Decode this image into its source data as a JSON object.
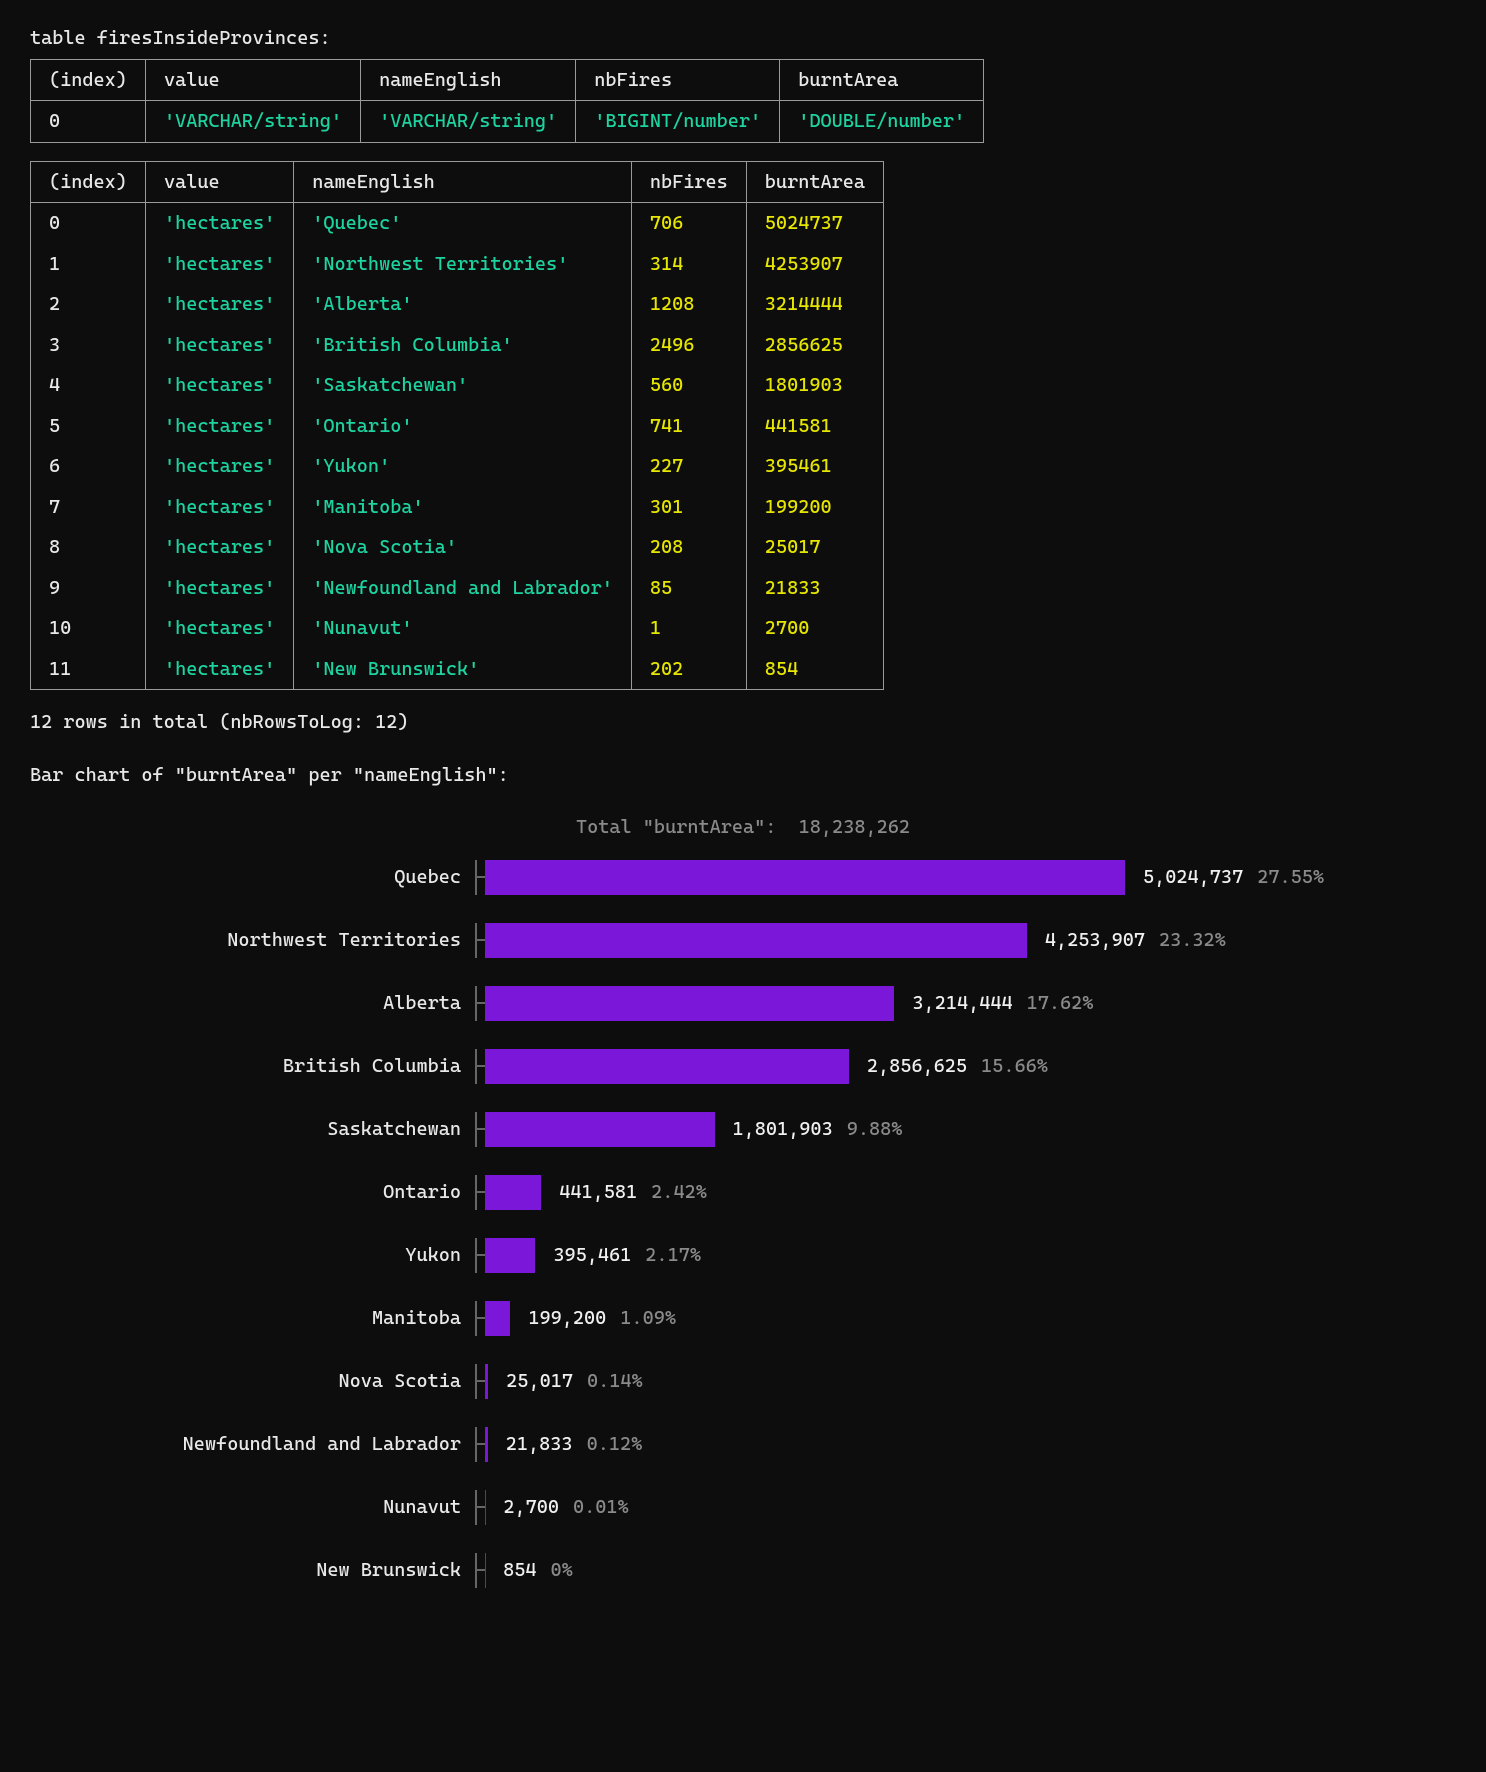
{
  "header": {
    "table_title": "table firesInsideProvinces:"
  },
  "schema_table": {
    "headers": [
      "(index)",
      "value",
      "nameEnglish",
      "nbFires",
      "burntArea"
    ],
    "rows": [
      {
        "index": "0",
        "value": "'VARCHAR/string'",
        "nameEnglish": "'VARCHAR/string'",
        "nbFires": "'BIGINT/number'",
        "burntArea": "'DOUBLE/number'"
      }
    ]
  },
  "data_table": {
    "headers": [
      "(index)",
      "value",
      "nameEnglish",
      "nbFires",
      "burntArea"
    ],
    "rows": [
      {
        "index": "0",
        "value": "'hectares'",
        "nameEnglish": "'Quebec'",
        "nbFires": "706",
        "burntArea": "5024737"
      },
      {
        "index": "1",
        "value": "'hectares'",
        "nameEnglish": "'Northwest Territories'",
        "nbFires": "314",
        "burntArea": "4253907"
      },
      {
        "index": "2",
        "value": "'hectares'",
        "nameEnglish": "'Alberta'",
        "nbFires": "1208",
        "burntArea": "3214444"
      },
      {
        "index": "3",
        "value": "'hectares'",
        "nameEnglish": "'British Columbia'",
        "nbFires": "2496",
        "burntArea": "2856625"
      },
      {
        "index": "4",
        "value": "'hectares'",
        "nameEnglish": "'Saskatchewan'",
        "nbFires": "560",
        "burntArea": "1801903"
      },
      {
        "index": "5",
        "value": "'hectares'",
        "nameEnglish": "'Ontario'",
        "nbFires": "741",
        "burntArea": "441581"
      },
      {
        "index": "6",
        "value": "'hectares'",
        "nameEnglish": "'Yukon'",
        "nbFires": "227",
        "burntArea": "395461"
      },
      {
        "index": "7",
        "value": "'hectares'",
        "nameEnglish": "'Manitoba'",
        "nbFires": "301",
        "burntArea": "199200"
      },
      {
        "index": "8",
        "value": "'hectares'",
        "nameEnglish": "'Nova Scotia'",
        "nbFires": "208",
        "burntArea": "25017"
      },
      {
        "index": "9",
        "value": "'hectares'",
        "nameEnglish": "'Newfoundland and Labrador'",
        "nbFires": "85",
        "burntArea": "21833"
      },
      {
        "index": "10",
        "value": "'hectares'",
        "nameEnglish": "'Nunavut'",
        "nbFires": "1",
        "burntArea": "2700"
      },
      {
        "index": "11",
        "value": "'hectares'",
        "nameEnglish": "'New Brunswick'",
        "nbFires": "202",
        "burntArea": "854"
      }
    ]
  },
  "summary": {
    "rows_total": "12 rows in total (nbRowsToLog: 12)",
    "chart_heading": "Bar chart of \"burntArea\" per \"nameEnglish\":",
    "chart_total_label": "Total \"burntArea\":",
    "chart_total_value": "18,238,262"
  },
  "chart_data": {
    "type": "bar",
    "title": "Bar chart of \"burntArea\" per \"nameEnglish\"",
    "xlabel": "burntArea",
    "ylabel": "nameEnglish",
    "total": 18238262,
    "categories": [
      "Quebec",
      "Northwest Territories",
      "Alberta",
      "British Columbia",
      "Saskatchewan",
      "Ontario",
      "Yukon",
      "Manitoba",
      "Nova Scotia",
      "Newfoundland and Labrador",
      "Nunavut",
      "New Brunswick"
    ],
    "values": [
      5024737,
      4253907,
      3214444,
      2856625,
      1801903,
      441581,
      395461,
      199200,
      25017,
      21833,
      2700,
      854
    ],
    "value_labels": [
      "5,024,737",
      "4,253,907",
      "3,214,444",
      "2,856,625",
      "1,801,903",
      "441,581",
      "395,461",
      "199,200",
      "25,017",
      "21,833",
      "2,700",
      "854"
    ],
    "percentages": [
      "27.55%",
      "23.32%",
      "17.62%",
      "15.66%",
      "9.88%",
      "2.42%",
      "2.17%",
      "1.09%",
      "0.14%",
      "0.12%",
      "0.01%",
      "0%"
    ],
    "bar_color": "#7b17d8"
  }
}
